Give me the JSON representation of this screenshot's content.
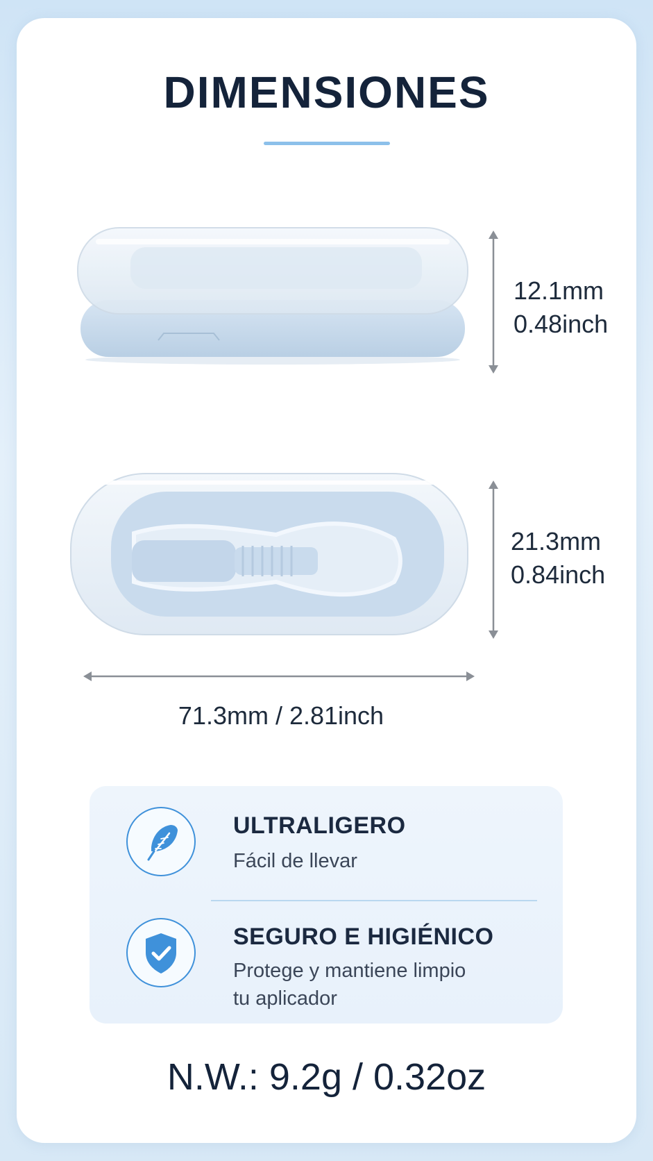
{
  "title": "DIMENSIONES",
  "height_dim": {
    "mm": "12.1mm",
    "inch": "0.48inch"
  },
  "depth_dim": {
    "mm": "21.3mm",
    "inch": "0.84inch"
  },
  "width_dim": "71.3mm  /  2.81inch",
  "features": [
    {
      "icon": "feather-icon",
      "title": "ULTRALIGERO",
      "desc": [
        "Fácil de llevar"
      ]
    },
    {
      "icon": "shield-check-icon",
      "title": "SEGURO E HIGIÉNICO",
      "desc": [
        "Protege y mantiene limpio",
        "tu aplicador"
      ]
    }
  ],
  "net_weight": "N.W.:  9.2g / 0.32oz",
  "colors": {
    "accent": "#3f91da",
    "case": "#c9dbed",
    "text": "#14233a"
  }
}
